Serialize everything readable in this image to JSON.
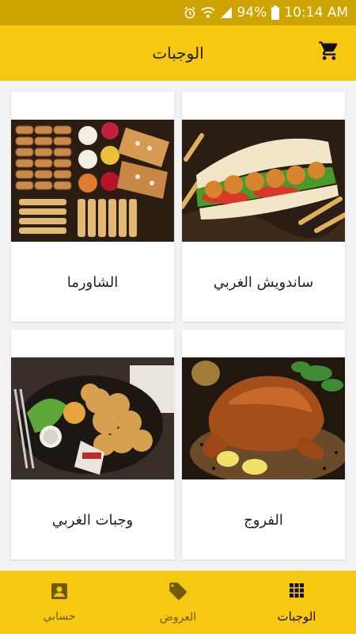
{
  "status": {
    "battery": "94%",
    "time": "10:14 AM"
  },
  "header": {
    "title": "الوجبات"
  },
  "meals": [
    {
      "label": "ساندويش الغربي",
      "image": "shrimp-sandwich-photo"
    },
    {
      "label": "الشاورما",
      "image": "shawarma-platter-photo"
    },
    {
      "label": "الفروج",
      "image": "roast-chicken-photo"
    },
    {
      "label": "وجبات الغربي",
      "image": "fried-meal-platter-photo"
    }
  ],
  "tabs": [
    {
      "label": "الوجبات",
      "icon": "grid-icon",
      "active": true
    },
    {
      "label": "العروض",
      "icon": "tag-icon",
      "active": false
    },
    {
      "label": "حسابي",
      "icon": "account-icon",
      "active": false
    }
  ],
  "colors": {
    "primary": "#f6c811",
    "statusbar": "#cda400"
  }
}
